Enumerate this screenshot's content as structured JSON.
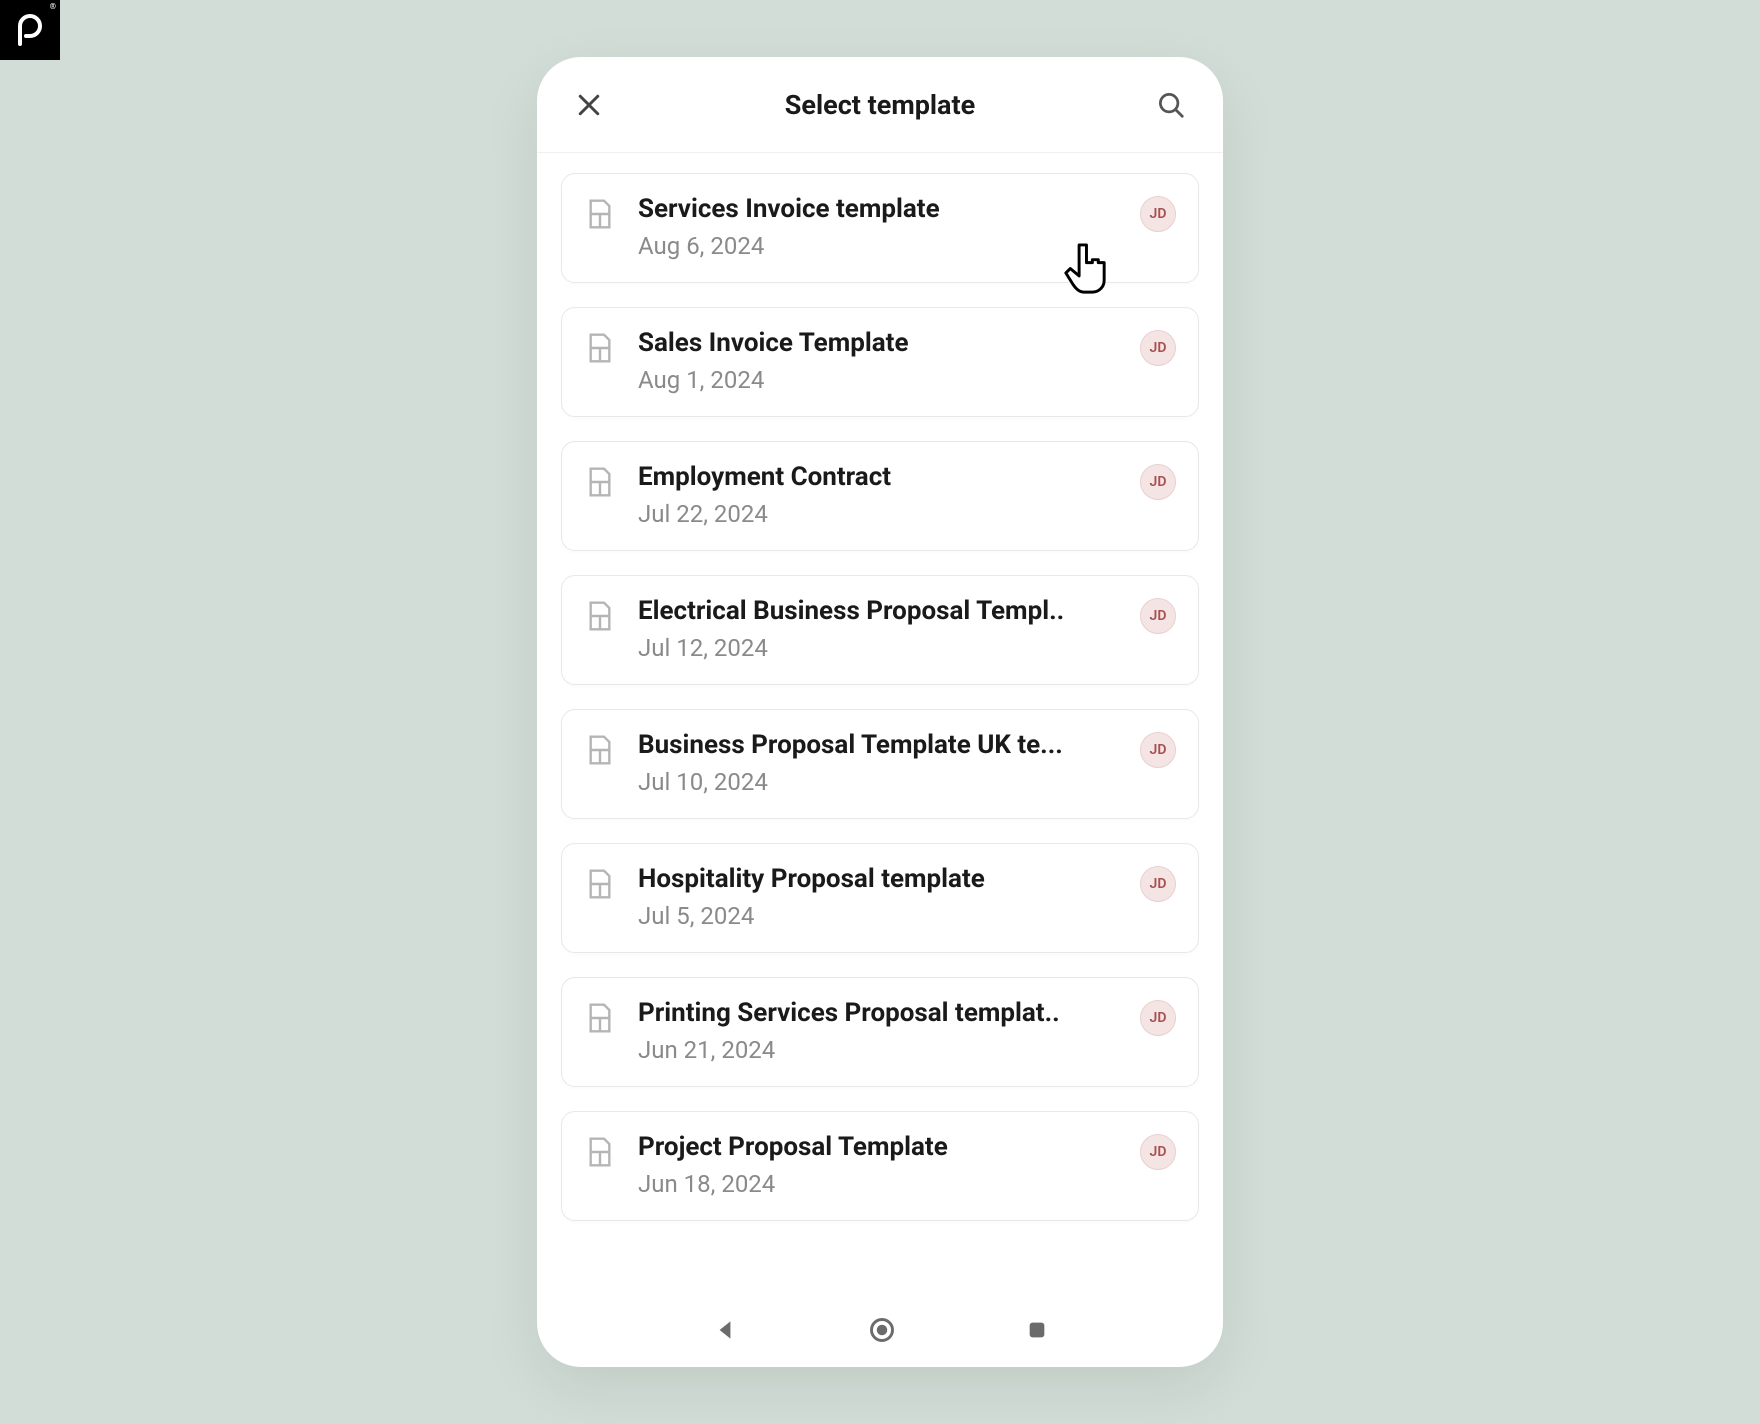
{
  "header": {
    "title": "Select template"
  },
  "avatarInitials": "JD",
  "templates": [
    {
      "title": "Services Invoice template",
      "date": "Aug 6, 2024"
    },
    {
      "title": "Sales Invoice Template",
      "date": "Aug 1, 2024"
    },
    {
      "title": "Employment Contract",
      "date": "Jul 22, 2024"
    },
    {
      "title": "Electrical Business Proposal Templ..",
      "date": "Jul 12, 2024"
    },
    {
      "title": "Business Proposal Template UK te...",
      "date": "Jul 10, 2024"
    },
    {
      "title": "Hospitality Proposal template",
      "date": "Jul 5, 2024"
    },
    {
      "title": "Printing Services Proposal templat..",
      "date": "Jun 21, 2024"
    },
    {
      "title": "Project Proposal Template",
      "date": "Jun 18, 2024"
    }
  ]
}
